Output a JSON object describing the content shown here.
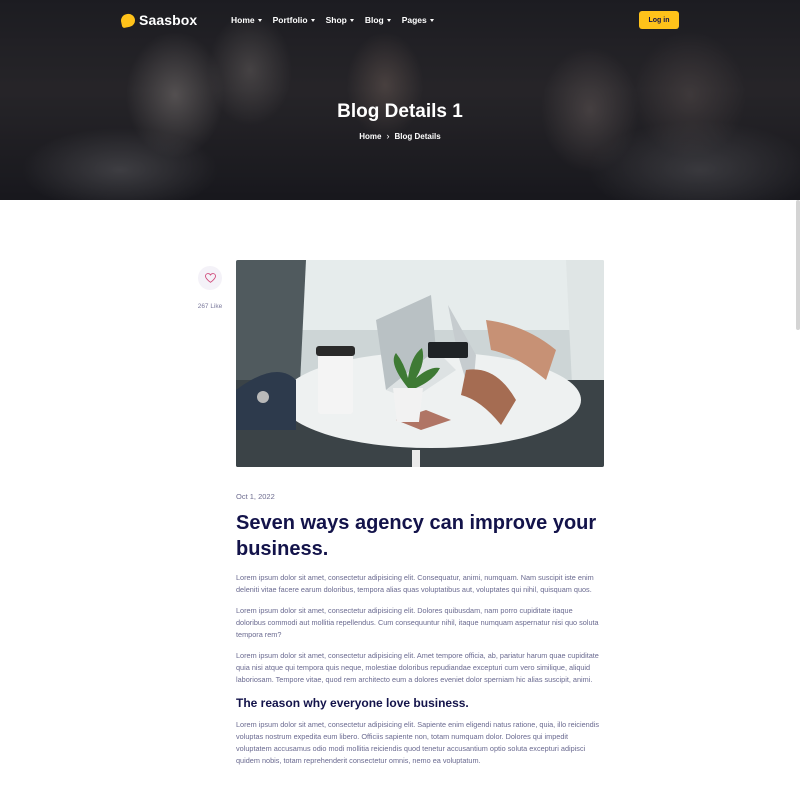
{
  "brand": {
    "name": "Saasbox",
    "logo_color": "#ffc21a"
  },
  "nav": {
    "items": [
      {
        "label": "Home",
        "has_dropdown": true
      },
      {
        "label": "Portfolio",
        "has_dropdown": true
      },
      {
        "label": "Shop",
        "has_dropdown": true
      },
      {
        "label": "Blog",
        "has_dropdown": true
      },
      {
        "label": "Pages",
        "has_dropdown": true
      }
    ],
    "login_label": "Log in"
  },
  "hero": {
    "title": "Blog Details 1",
    "breadcrumb": {
      "home": "Home",
      "separator": "›",
      "current": "Blog Details"
    }
  },
  "like": {
    "icon": "heart-icon",
    "count_label": "267 Like"
  },
  "post": {
    "date": "Oct 1, 2022",
    "title": "Seven ways agency can improve your business.",
    "paragraphs": [
      "Lorem ipsum dolor sit amet, consectetur adipisicing elit. Consequatur, animi, numquam. Nam suscipit iste enim deleniti vitae facere earum doloribus, tempora alias quas voluptatibus aut, voluptates qui nihil, quisquam quos.",
      "Lorem ipsum dolor sit amet, consectetur adipisicing elit. Dolores quibusdam, nam porro cupiditate itaque doloribus commodi aut mollitia repellendus. Cum consequuntur nihil, itaque numquam aspernatur nisi quo soluta tempora rem?",
      "Lorem ipsum dolor sit amet, consectetur adipisicing elit. Amet tempore officia, ab, pariatur harum quae cupiditate quia nisi atque qui tempora quis neque, molestiae doloribus repudiandae excepturi cum vero similique, aliquid laboriosam. Tempore vitae, quod rem architecto eum a dolores eveniet dolor sperniam hic alias suscipit, animi."
    ],
    "subheading": "The reason why everyone love business.",
    "paragraphs_after": [
      "Lorem ipsum dolor sit amet, consectetur adipisicing elit. Sapiente enim eligendi natus ratione, quia, illo reiciendis voluptas nostrum expedita eum libero. Officiis sapiente non, totam numquam dolor. Dolores qui impedit voluptatem accusamus odio modi mollitia reiciendis quod tenetur accusantium optio soluta excepturi adipisci quidem nobis, totam reprehenderit consectetur omnis, nemo ea voluptatum."
    ]
  },
  "colors": {
    "accent": "#ffc21a",
    "heading": "#13134a",
    "body_text": "#6a6a90",
    "like_heart": "#d04a7a"
  }
}
